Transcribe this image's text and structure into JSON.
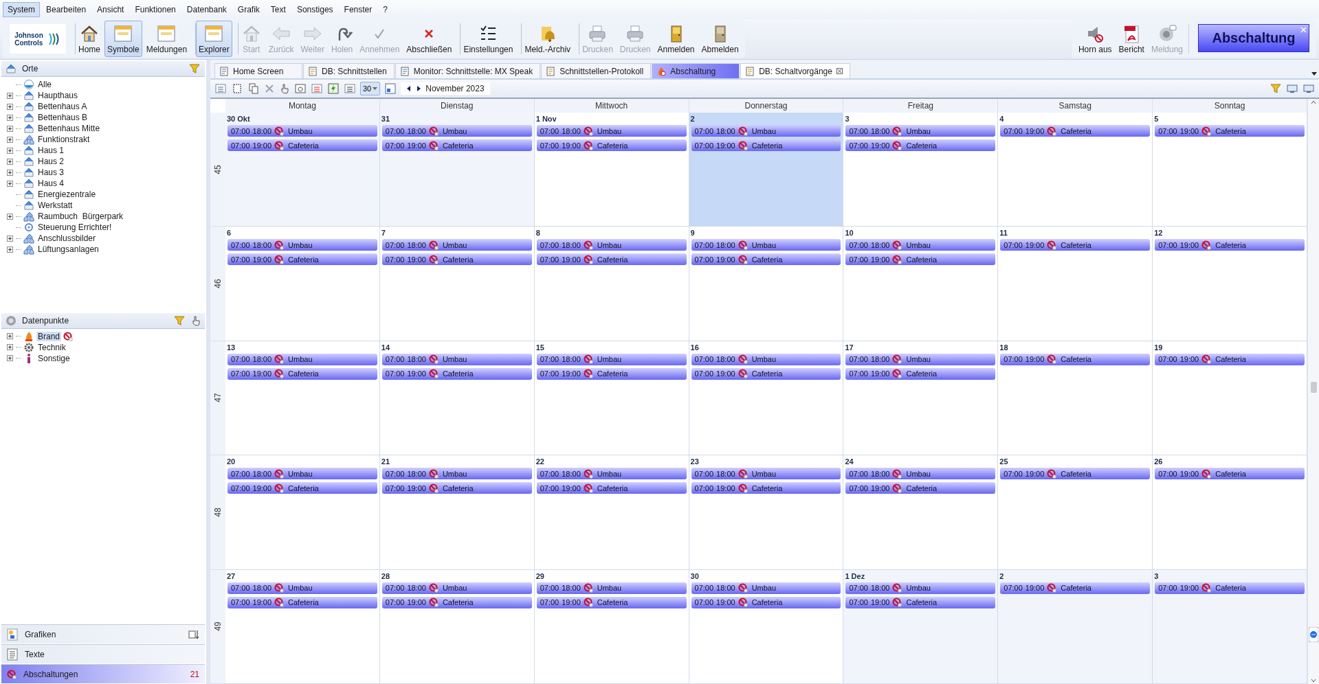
{
  "menu": [
    {
      "label": "System",
      "selected": true
    },
    {
      "label": "Bearbeiten",
      "selected": false
    },
    {
      "label": "Ansicht",
      "selected": false
    },
    {
      "label": "Funktionen",
      "selected": false
    },
    {
      "label": "Datenbank",
      "selected": false
    },
    {
      "label": "Grafik",
      "selected": false
    },
    {
      "label": "Text",
      "selected": false
    },
    {
      "label": "Sonstiges",
      "selected": false
    },
    {
      "label": "Fenster",
      "selected": false
    },
    {
      "label": "?",
      "selected": false
    }
  ],
  "logo": {
    "lines": [
      "Johnson",
      "Controls"
    ]
  },
  "toolbar": [
    {
      "label": "Home",
      "selected": false,
      "disabled": false,
      "separator_before": true
    },
    {
      "label": "Symbole",
      "selected": true,
      "disabled": false,
      "separator_before": false
    },
    {
      "label": "Meldungen",
      "selected": false,
      "disabled": false,
      "separator_before": false
    },
    {
      "label": "Explorer",
      "selected": true,
      "disabled": false,
      "separator_before": true
    },
    {
      "label": "Start",
      "selected": false,
      "disabled": true,
      "separator_before": true
    },
    {
      "label": "Zurück",
      "selected": false,
      "disabled": true,
      "separator_before": false
    },
    {
      "label": "Weiter",
      "selected": false,
      "disabled": true,
      "separator_before": false
    },
    {
      "label": "Holen",
      "selected": false,
      "disabled": true,
      "separator_before": false
    },
    {
      "label": "Annehmen",
      "selected": false,
      "disabled": true,
      "separator_before": false
    },
    {
      "label": "Abschließen",
      "selected": false,
      "disabled": false,
      "separator_before": false
    },
    {
      "label": "Einstellungen",
      "selected": false,
      "disabled": false,
      "separator_before": true
    },
    {
      "label": "Meld.-Archiv",
      "selected": false,
      "disabled": false,
      "separator_before": true
    },
    {
      "label": "Drucken",
      "selected": false,
      "disabled": true,
      "separator_before": true
    },
    {
      "label": "Drucken",
      "selected": false,
      "disabled": true,
      "separator_before": false
    },
    {
      "label": "Anmelden",
      "selected": false,
      "disabled": false,
      "separator_before": false
    },
    {
      "label": "Abmelden",
      "selected": false,
      "disabled": false,
      "separator_before": false
    }
  ],
  "right_toolbar": [
    {
      "label": "Horn aus",
      "disabled": false
    },
    {
      "label": "Bericht",
      "disabled": false
    },
    {
      "label": "Meldung",
      "disabled": true
    }
  ],
  "alarm_button": {
    "label": "Abschaltung"
  },
  "orte": {
    "title": "Orte",
    "items": [
      {
        "label": "Alle",
        "kind": "all",
        "expandable": false
      },
      {
        "label": "Haupthaus",
        "kind": "building",
        "expandable": true
      },
      {
        "label": "Bettenhaus A",
        "kind": "building",
        "expandable": true
      },
      {
        "label": "Bettenhaus B",
        "kind": "building",
        "expandable": true
      },
      {
        "label": "Bettenhaus Mitte",
        "kind": "building",
        "expandable": true
      },
      {
        "label": "Funktionstrakt",
        "kind": "complex",
        "expandable": true
      },
      {
        "label": "Haus 1",
        "kind": "building",
        "expandable": true
      },
      {
        "label": "Haus 2",
        "kind": "building",
        "expandable": true
      },
      {
        "label": "Haus 3",
        "kind": "building",
        "expandable": true
      },
      {
        "label": "Haus 4",
        "kind": "building",
        "expandable": true
      },
      {
        "label": "Energiezentrale",
        "kind": "building",
        "expandable": false
      },
      {
        "label": "Werkstatt",
        "kind": "building",
        "expandable": false
      },
      {
        "label": "Raumbuch  Bürgerpark",
        "kind": "complex",
        "expandable": true
      },
      {
        "label": "Steuerung Errichter!",
        "kind": "control",
        "expandable": false
      },
      {
        "label": "Anschlussbilder",
        "kind": "complex",
        "expandable": true
      },
      {
        "label": "Lüftungsanlagen",
        "kind": "complex",
        "expandable": true
      }
    ]
  },
  "datenpunkte": {
    "title": "Datenpunkte",
    "items": [
      {
        "label": "Brand",
        "kind": "fire",
        "selected": true,
        "blocked": true
      },
      {
        "label": "Technik",
        "kind": "gear",
        "selected": false,
        "blocked": false
      },
      {
        "label": "Sonstige",
        "kind": "info",
        "selected": false,
        "blocked": false
      }
    ]
  },
  "bottom_items": [
    {
      "label": "Grafiken",
      "selected": false
    },
    {
      "label": "Texte",
      "selected": false
    },
    {
      "label": "Abschaltungen",
      "selected": true,
      "count": "21"
    }
  ],
  "tabs": [
    {
      "label": "Home Screen",
      "selected": false,
      "alert": false,
      "closable": false
    },
    {
      "label": "DB: Schnittstellen",
      "selected": false,
      "alert": false,
      "closable": false
    },
    {
      "label": "Monitor: Schnittstelle: MX Speak",
      "selected": false,
      "alert": false,
      "closable": false
    },
    {
      "label": "Schnittstellen-Protokoll",
      "selected": false,
      "alert": false,
      "closable": false
    },
    {
      "label": "Abschaltung",
      "selected": false,
      "alert": true,
      "closable": false
    },
    {
      "label": "DB: Schaltvorgänge",
      "selected": true,
      "alert": false,
      "closable": true
    }
  ],
  "calendar_toolbar": {
    "view_days": "30",
    "month": "November 2023"
  },
  "weekdays": [
    "Montag",
    "Dienstag",
    "Mittwoch",
    "Donnerstag",
    "Freitag",
    "Samstag",
    "Sonntag"
  ],
  "weeks": [
    {
      "number": "45",
      "days": [
        {
          "label": "30 Okt",
          "in_month": false,
          "selected": false,
          "events": [
            {
              "start": "07:00",
              "end": "18:00",
              "title": "Umbau"
            },
            {
              "start": "07:00",
              "end": "19:00",
              "title": "Cafeteria"
            }
          ]
        },
        {
          "label": "31",
          "in_month": false,
          "selected": false,
          "events": [
            {
              "start": "07:00",
              "end": "18:00",
              "title": "Umbau"
            },
            {
              "start": "07:00",
              "end": "19:00",
              "title": "Cafeteria"
            }
          ]
        },
        {
          "label": "1 Nov",
          "in_month": true,
          "selected": false,
          "events": [
            {
              "start": "07:00",
              "end": "18:00",
              "title": "Umbau"
            },
            {
              "start": "07:00",
              "end": "19:00",
              "title": "Cafeteria"
            }
          ]
        },
        {
          "label": "2",
          "in_month": true,
          "selected": true,
          "events": [
            {
              "start": "07:00",
              "end": "18:00",
              "title": "Umbau"
            },
            {
              "start": "07:00",
              "end": "19:00",
              "title": "Cafeteria"
            }
          ]
        },
        {
          "label": "3",
          "in_month": true,
          "selected": false,
          "events": [
            {
              "start": "07:00",
              "end": "18:00",
              "title": "Umbau"
            },
            {
              "start": "07:00",
              "end": "19:00",
              "title": "Cafeteria"
            }
          ]
        },
        {
          "label": "4",
          "in_month": true,
          "selected": false,
          "events": [
            {
              "start": "07:00",
              "end": "19:00",
              "title": "Cafeteria"
            }
          ]
        },
        {
          "label": "5",
          "in_month": true,
          "selected": false,
          "events": [
            {
              "start": "07:00",
              "end": "19:00",
              "title": "Cafeteria"
            }
          ]
        }
      ]
    },
    {
      "number": "46",
      "days": [
        {
          "label": "6",
          "in_month": true,
          "selected": false,
          "events": [
            {
              "start": "07:00",
              "end": "18:00",
              "title": "Umbau"
            },
            {
              "start": "07:00",
              "end": "19:00",
              "title": "Cafeteria"
            }
          ]
        },
        {
          "label": "7",
          "in_month": true,
          "selected": false,
          "events": [
            {
              "start": "07:00",
              "end": "18:00",
              "title": "Umbau"
            },
            {
              "start": "07:00",
              "end": "19:00",
              "title": "Cafeteria"
            }
          ]
        },
        {
          "label": "8",
          "in_month": true,
          "selected": false,
          "events": [
            {
              "start": "07:00",
              "end": "18:00",
              "title": "Umbau"
            },
            {
              "start": "07:00",
              "end": "19:00",
              "title": "Cafeteria"
            }
          ]
        },
        {
          "label": "9",
          "in_month": true,
          "selected": false,
          "events": [
            {
              "start": "07:00",
              "end": "18:00",
              "title": "Umbau"
            },
            {
              "start": "07:00",
              "end": "19:00",
              "title": "Cafeteria"
            }
          ]
        },
        {
          "label": "10",
          "in_month": true,
          "selected": false,
          "events": [
            {
              "start": "07:00",
              "end": "18:00",
              "title": "Umbau"
            },
            {
              "start": "07:00",
              "end": "19:00",
              "title": "Cafeteria"
            }
          ]
        },
        {
          "label": "11",
          "in_month": true,
          "selected": false,
          "events": [
            {
              "start": "07:00",
              "end": "19:00",
              "title": "Cafeteria"
            }
          ]
        },
        {
          "label": "12",
          "in_month": true,
          "selected": false,
          "events": [
            {
              "start": "07:00",
              "end": "19:00",
              "title": "Cafeteria"
            }
          ]
        }
      ]
    },
    {
      "number": "47",
      "days": [
        {
          "label": "13",
          "in_month": true,
          "selected": false,
          "events": [
            {
              "start": "07:00",
              "end": "18:00",
              "title": "Umbau"
            },
            {
              "start": "07:00",
              "end": "19:00",
              "title": "Cafeteria"
            }
          ]
        },
        {
          "label": "14",
          "in_month": true,
          "selected": false,
          "events": [
            {
              "start": "07:00",
              "end": "18:00",
              "title": "Umbau"
            },
            {
              "start": "07:00",
              "end": "19:00",
              "title": "Cafeteria"
            }
          ]
        },
        {
          "label": "15",
          "in_month": true,
          "selected": false,
          "events": [
            {
              "start": "07:00",
              "end": "18:00",
              "title": "Umbau"
            },
            {
              "start": "07:00",
              "end": "19:00",
              "title": "Cafeteria"
            }
          ]
        },
        {
          "label": "16",
          "in_month": true,
          "selected": false,
          "events": [
            {
              "start": "07:00",
              "end": "18:00",
              "title": "Umbau"
            },
            {
              "start": "07:00",
              "end": "19:00",
              "title": "Cafeteria"
            }
          ]
        },
        {
          "label": "17",
          "in_month": true,
          "selected": false,
          "events": [
            {
              "start": "07:00",
              "end": "18:00",
              "title": "Umbau"
            },
            {
              "start": "07:00",
              "end": "19:00",
              "title": "Cafeteria"
            }
          ]
        },
        {
          "label": "18",
          "in_month": true,
          "selected": false,
          "events": [
            {
              "start": "07:00",
              "end": "19:00",
              "title": "Cafeteria"
            }
          ]
        },
        {
          "label": "19",
          "in_month": true,
          "selected": false,
          "events": [
            {
              "start": "07:00",
              "end": "19:00",
              "title": "Cafeteria"
            }
          ]
        }
      ]
    },
    {
      "number": "48",
      "days": [
        {
          "label": "20",
          "in_month": true,
          "selected": false,
          "events": [
            {
              "start": "07:00",
              "end": "18:00",
              "title": "Umbau"
            },
            {
              "start": "07:00",
              "end": "19:00",
              "title": "Cafeteria"
            }
          ]
        },
        {
          "label": "21",
          "in_month": true,
          "selected": false,
          "events": [
            {
              "start": "07:00",
              "end": "18:00",
              "title": "Umbau"
            },
            {
              "start": "07:00",
              "end": "19:00",
              "title": "Cafeteria"
            }
          ]
        },
        {
          "label": "22",
          "in_month": true,
          "selected": false,
          "events": [
            {
              "start": "07:00",
              "end": "18:00",
              "title": "Umbau"
            },
            {
              "start": "07:00",
              "end": "19:00",
              "title": "Cafeteria"
            }
          ]
        },
        {
          "label": "23",
          "in_month": true,
          "selected": false,
          "events": [
            {
              "start": "07:00",
              "end": "18:00",
              "title": "Umbau"
            },
            {
              "start": "07:00",
              "end": "19:00",
              "title": "Cafeteria"
            }
          ]
        },
        {
          "label": "24",
          "in_month": true,
          "selected": false,
          "events": [
            {
              "start": "07:00",
              "end": "18:00",
              "title": "Umbau"
            },
            {
              "start": "07:00",
              "end": "19:00",
              "title": "Cafeteria"
            }
          ]
        },
        {
          "label": "25",
          "in_month": true,
          "selected": false,
          "events": [
            {
              "start": "07:00",
              "end": "19:00",
              "title": "Cafeteria"
            }
          ]
        },
        {
          "label": "26",
          "in_month": true,
          "selected": false,
          "events": [
            {
              "start": "07:00",
              "end": "19:00",
              "title": "Cafeteria"
            }
          ]
        }
      ]
    },
    {
      "number": "49",
      "days": [
        {
          "label": "27",
          "in_month": true,
          "selected": false,
          "events": [
            {
              "start": "07:00",
              "end": "18:00",
              "title": "Umbau"
            },
            {
              "start": "07:00",
              "end": "19:00",
              "title": "Cafeteria"
            }
          ]
        },
        {
          "label": "28",
          "in_month": true,
          "selected": false,
          "events": [
            {
              "start": "07:00",
              "end": "18:00",
              "title": "Umbau"
            },
            {
              "start": "07:00",
              "end": "19:00",
              "title": "Cafeteria"
            }
          ]
        },
        {
          "label": "29",
          "in_month": true,
          "selected": false,
          "events": [
            {
              "start": "07:00",
              "end": "18:00",
              "title": "Umbau"
            },
            {
              "start": "07:00",
              "end": "19:00",
              "title": "Cafeteria"
            }
          ]
        },
        {
          "label": "30",
          "in_month": true,
          "selected": false,
          "events": [
            {
              "start": "07:00",
              "end": "18:00",
              "title": "Umbau"
            },
            {
              "start": "07:00",
              "end": "19:00",
              "title": "Cafeteria"
            }
          ]
        },
        {
          "label": "1 Dez",
          "in_month": false,
          "selected": false,
          "events": [
            {
              "start": "07:00",
              "end": "18:00",
              "title": "Umbau"
            },
            {
              "start": "07:00",
              "end": "19:00",
              "title": "Cafeteria"
            }
          ]
        },
        {
          "label": "2",
          "in_month": false,
          "selected": false,
          "events": [
            {
              "start": "07:00",
              "end": "19:00",
              "title": "Cafeteria"
            }
          ]
        },
        {
          "label": "3",
          "in_month": false,
          "selected": false,
          "events": [
            {
              "start": "07:00",
              "end": "19:00",
              "title": "Cafeteria"
            }
          ]
        }
      ]
    }
  ]
}
